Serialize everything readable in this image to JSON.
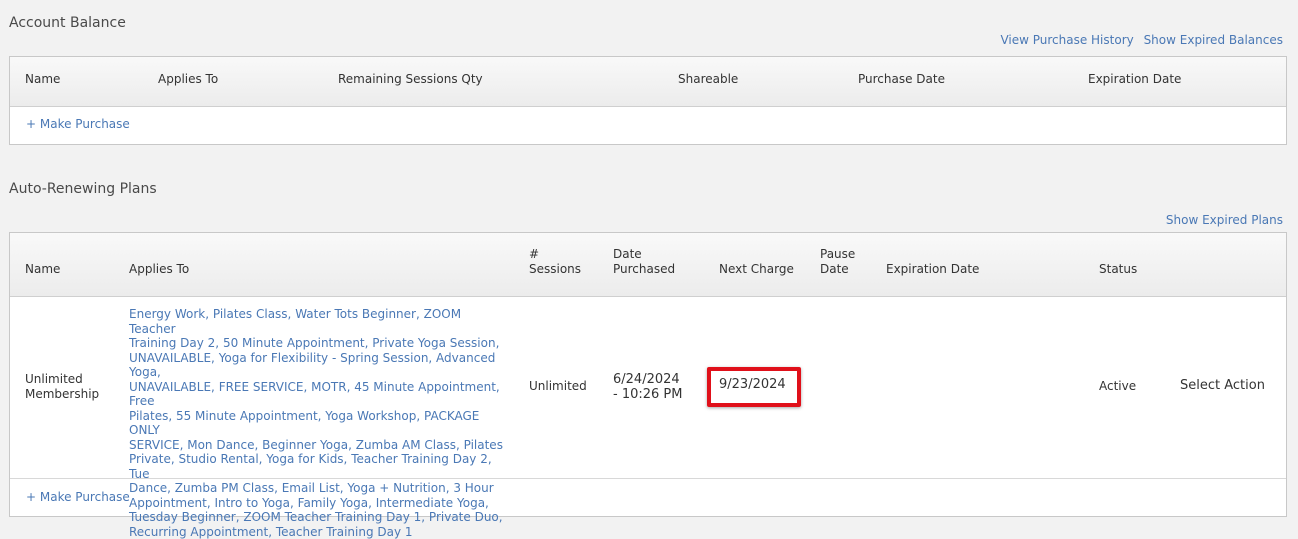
{
  "account_balance": {
    "title": "Account Balance",
    "links": [
      "View Purchase History",
      "Show Expired Balances"
    ],
    "columns": [
      "Name",
      "Applies To",
      "Remaining Sessions Qty",
      "Shareable",
      "Purchase Date",
      "Expiration Date"
    ],
    "make_purchase": "+ Make Purchase"
  },
  "auto_renewing": {
    "title": "Auto-Renewing Plans",
    "links": [
      "Show Expired Plans"
    ],
    "columns": {
      "name": "Name",
      "applies_to": "Applies To",
      "sessions_1": "#",
      "sessions_2": "Sessions",
      "date_purchased_1": "Date",
      "date_purchased_2": "Purchased",
      "next_charge": "Next Charge",
      "pause_date_1": "Pause",
      "pause_date_2": "Date",
      "expiration_date": "Expiration Date",
      "status": "Status"
    },
    "row": {
      "name_1": "Unlimited",
      "name_2": "Membership",
      "applies_to_lines": [
        "Energy Work, Pilates Class, Water Tots Beginner, ZOOM Teacher",
        "Training Day 2, 50 Minute Appointment, Private Yoga Session,",
        "UNAVAILABLE, Yoga for Flexibility - Spring Session, Advanced Yoga,",
        "UNAVAILABLE, FREE SERVICE, MOTR, 45 Minute Appointment, Free",
        "Pilates, 55 Minute Appointment, Yoga Workshop, PACKAGE ONLY",
        "SERVICE, Mon Dance, Beginner Yoga, Zumba AM Class, Pilates",
        "Private, Studio Rental, Yoga for Kids, Teacher Training Day 2, Tue",
        "Dance, Zumba PM Class, Email List, Yoga + Nutrition, 3 Hour",
        "Appointment, Intro to Yoga, Family Yoga, Intermediate Yoga,",
        "Tuesday Beginner, ZOOM Teacher Training Day 1, Private Duo,",
        "Recurring Appointment, Teacher Training Day 1"
      ],
      "sessions": "Unlimited",
      "date_purchased_1": "6/24/2024",
      "date_purchased_2": "- 10:26 PM",
      "next_charge": "9/23/2024",
      "pause_date": "",
      "expiration_date": "",
      "status": "Active",
      "action": "Select Action"
    },
    "make_purchase": "+ Make Purchase"
  },
  "colors": {
    "link": "#4a78b5",
    "highlight": "#e0101a",
    "background": "#f2f2f2"
  }
}
